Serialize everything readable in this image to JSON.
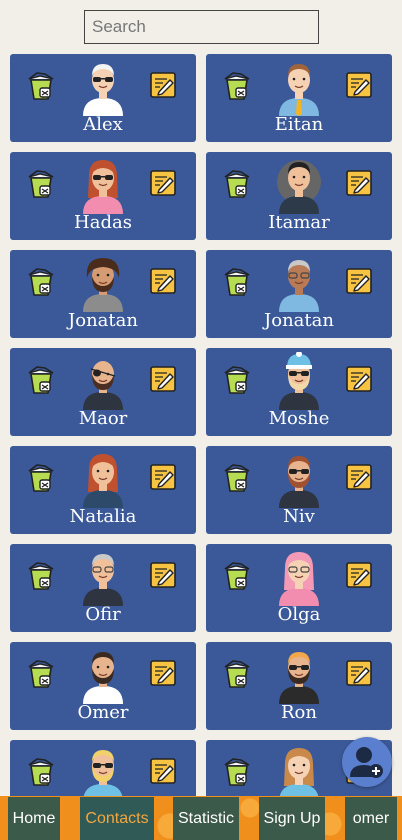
{
  "search": {
    "placeholder": "Search",
    "value": ""
  },
  "contacts": [
    {
      "name": "Alex",
      "avatar": "avatar-sunglasses-white-hair"
    },
    {
      "name": "Eitan",
      "avatar": "avatar-suit-tie"
    },
    {
      "name": "Hadas",
      "avatar": "avatar-woman-red-hair"
    },
    {
      "name": "Itamar",
      "avatar": "avatar-suit-dark"
    },
    {
      "name": "Jonatan",
      "avatar": "avatar-curly-hair"
    },
    {
      "name": "Jonatan",
      "avatar": "avatar-glasses-hoodie"
    },
    {
      "name": "Maor",
      "avatar": "avatar-eyepatch"
    },
    {
      "name": "Moshe",
      "avatar": "avatar-beanie"
    },
    {
      "name": "Natalia",
      "avatar": "avatar-woman-brown-hair"
    },
    {
      "name": "Niv",
      "avatar": "avatar-sunglasses-beard"
    },
    {
      "name": "Ofir",
      "avatar": "avatar-grey-hair-glasses"
    },
    {
      "name": "Olga",
      "avatar": "avatar-woman-pink-hair"
    },
    {
      "name": "Omer",
      "avatar": "avatar-beard-white-shirt"
    },
    {
      "name": "Ron",
      "avatar": "avatar-sunglasses-black-shirt"
    },
    {
      "name": "",
      "avatar": "avatar-blonde-sunglasses"
    },
    {
      "name": "",
      "avatar": "avatar-woman-ponytail"
    }
  ],
  "nav": {
    "home": "Home",
    "contacts": "Contacts",
    "statistic": "Statistic",
    "signup": "Sign Up",
    "user": "omer"
  },
  "colors": {
    "card_bg": "#3b5998",
    "nav_bg": "#f18f1d",
    "active_text": "#f3a640"
  }
}
